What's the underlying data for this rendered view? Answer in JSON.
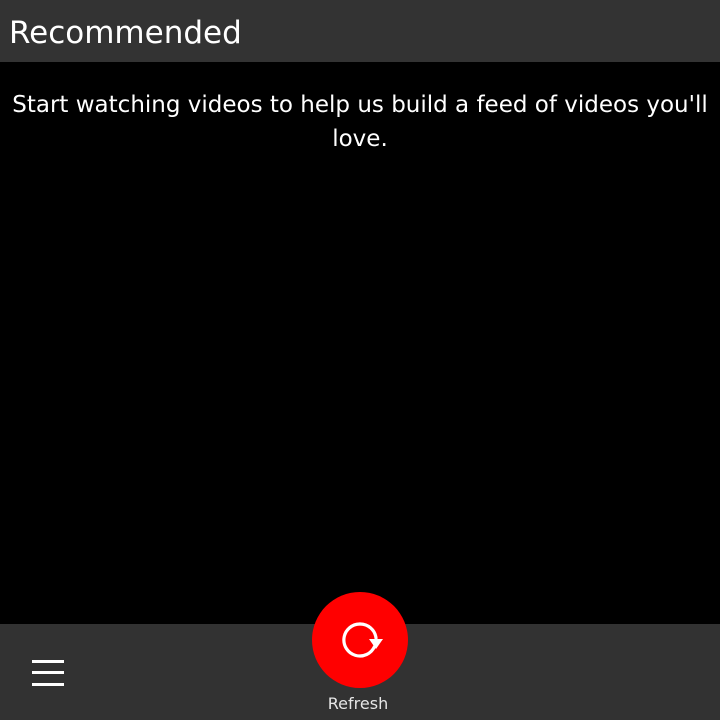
{
  "header": {
    "title": "Recommended"
  },
  "main": {
    "empty_message": "Start watching videos to help us build a feed of videos you'll love."
  },
  "action_bar": {
    "menu_icon": "hamburger-menu-icon",
    "refresh": {
      "label": "Refresh",
      "icon": "refresh-icon"
    }
  },
  "colors": {
    "title_bar_bg": "#333333",
    "content_bg": "#000000",
    "action_bar_bg": "#323232",
    "accent": "#ff0000",
    "text": "#ffffff"
  }
}
